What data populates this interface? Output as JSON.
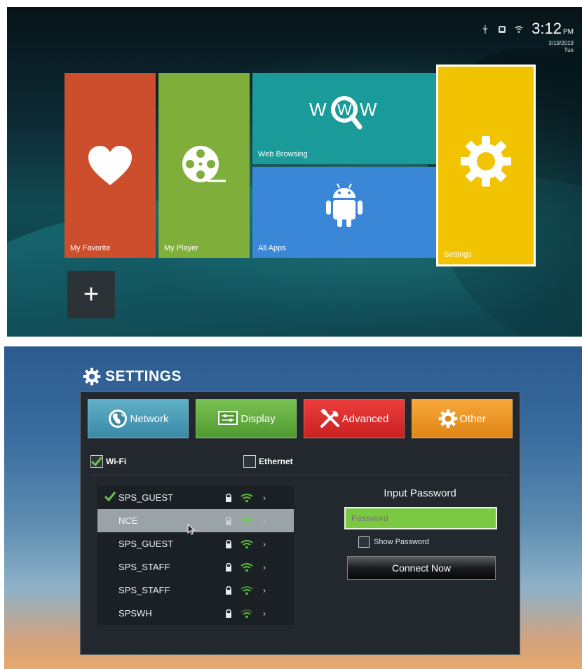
{
  "launcher": {
    "status": {
      "icons": [
        "usb-icon",
        "sd-card-icon",
        "wifi-icon"
      ],
      "time": "3:12",
      "ampm": "PM",
      "date": "3/19/2019",
      "day": "Tue"
    },
    "tiles": {
      "favorite": {
        "label": "My Favorite",
        "icon": "heart-icon",
        "color": "#cd4e2c"
      },
      "player": {
        "label": "My Player",
        "icon": "film-reel-icon",
        "color": "#7fae3a"
      },
      "web": {
        "label": "Web Browsing",
        "icon": "www-search-icon",
        "color": "#1a9a98"
      },
      "apps": {
        "label": "All Apps",
        "icon": "android-icon",
        "color": "#3a87d8"
      },
      "settings": {
        "label": "Settings",
        "icon": "gear-icon",
        "color": "#f2c300"
      },
      "add": {
        "label": "+",
        "icon": "plus-icon"
      }
    }
  },
  "settings": {
    "title": "SETTINGS",
    "tabs": [
      {
        "label": "Network",
        "icon": "globe-icon",
        "color": "#3a8aa6"
      },
      {
        "label": "Display",
        "icon": "display-icon",
        "color": "#4f9a31"
      },
      {
        "label": "Advanced",
        "icon": "tools-icon",
        "color": "#c92121"
      },
      {
        "label": "Other",
        "icon": "gear-icon",
        "color": "#e08616"
      }
    ],
    "wifi": {
      "label": "Wi-Fi",
      "checked": true
    },
    "ethernet": {
      "label": "Ethernet",
      "checked": false
    },
    "networks": [
      {
        "ssid": "SPS_GUEST",
        "connected": true,
        "selected": false
      },
      {
        "ssid": "NCE",
        "connected": false,
        "selected": true
      },
      {
        "ssid": "SPS_GUEST",
        "connected": false,
        "selected": false
      },
      {
        "ssid": "SPS_STAFF",
        "connected": false,
        "selected": false
      },
      {
        "ssid": "SPS_STAFF",
        "connected": false,
        "selected": false
      },
      {
        "ssid": "SPSWH",
        "connected": false,
        "selected": false
      }
    ],
    "password": {
      "title": "Input Password",
      "placeholder": "Password",
      "value": "",
      "show_label": "Show Password",
      "show_checked": false,
      "connect_label": "Connect Now"
    }
  }
}
